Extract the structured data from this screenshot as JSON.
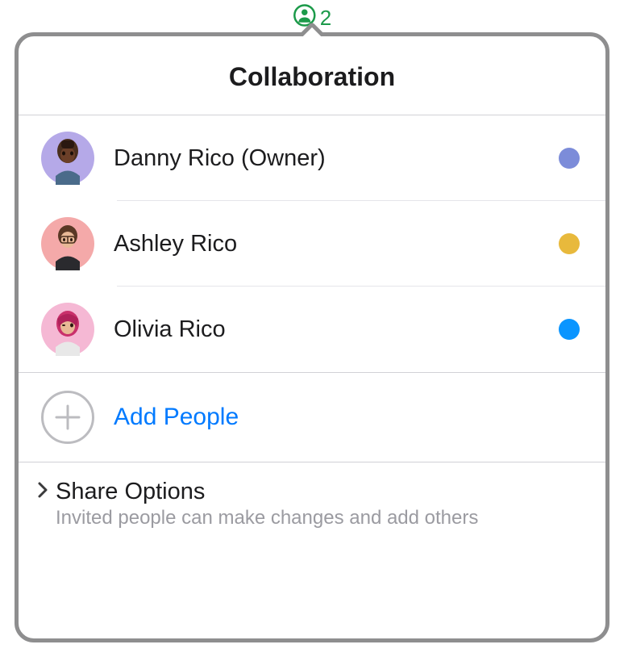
{
  "indicator": {
    "count": "2"
  },
  "popover": {
    "title": "Collaboration",
    "people": [
      {
        "name": "Danny Rico (Owner)",
        "avatar_bg": "#b5a9e8",
        "status_color": "#7c8cd9"
      },
      {
        "name": "Ashley Rico",
        "avatar_bg": "#f4a9a9",
        "status_color": "#e8b93c"
      },
      {
        "name": "Olivia Rico",
        "avatar_bg": "#f5b8d4",
        "status_color": "#0a95ff"
      }
    ],
    "add_label": "Add People",
    "share": {
      "title": "Share Options",
      "subtitle": "Invited people can make changes and add others"
    }
  }
}
